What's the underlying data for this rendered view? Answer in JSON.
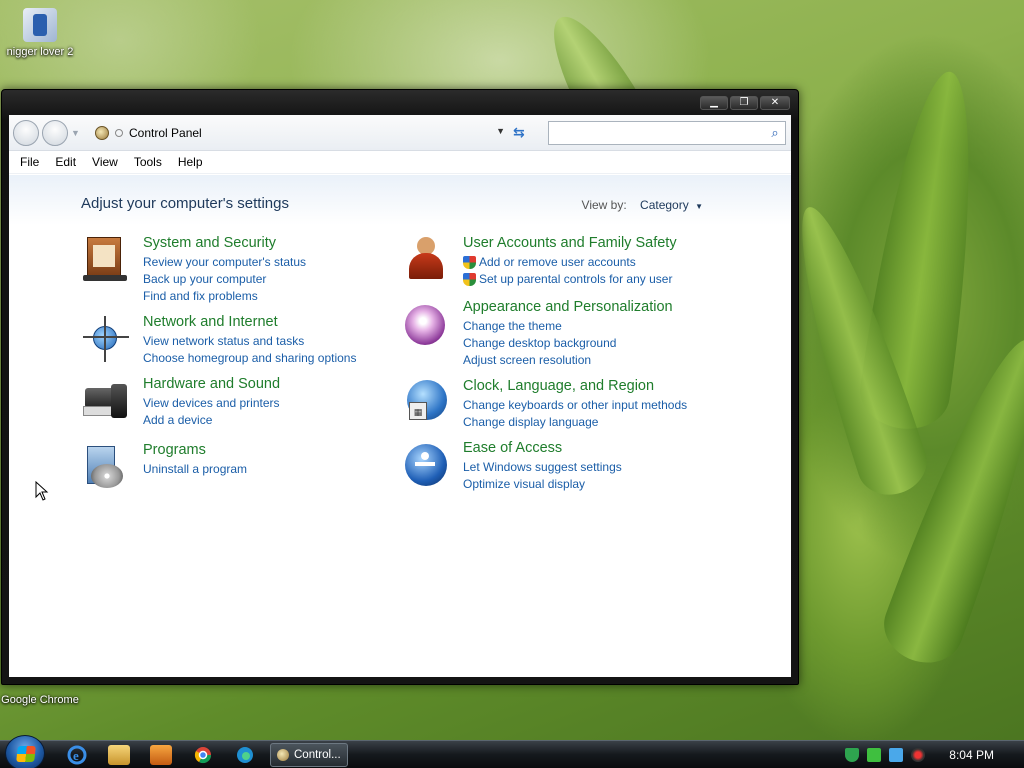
{
  "desktop": {
    "icons": [
      {
        "label": "nigger lover 2"
      },
      {
        "label": "Google Chrome"
      }
    ]
  },
  "window": {
    "controls": {
      "minimize": "▁",
      "maximize": "❐",
      "close": "✕"
    },
    "address": {
      "crumb": "Control Panel"
    },
    "search": {
      "placeholder": ""
    },
    "menu": [
      "File",
      "Edit",
      "View",
      "Tools",
      "Help"
    ],
    "content": {
      "title": "Adjust your computer's settings",
      "view_by_label": "View by:",
      "view_by_value": "Category",
      "categories": [
        {
          "title": "System and Security",
          "links": [
            "Review your computer's status",
            "Back up your computer",
            "Find and fix problems"
          ]
        },
        {
          "title": "Network and Internet",
          "links": [
            "View network status and tasks",
            "Choose homegroup and sharing options"
          ]
        },
        {
          "title": "Hardware and Sound",
          "links": [
            "View devices and printers",
            "Add a device"
          ]
        },
        {
          "title": "Programs",
          "links": [
            "Uninstall a program"
          ]
        },
        {
          "title": "User Accounts and Family Safety",
          "links": [
            "Add or remove user accounts",
            "Set up parental controls for any user"
          ]
        },
        {
          "title": "Appearance and Personalization",
          "links": [
            "Change the theme",
            "Change desktop background",
            "Adjust screen resolution"
          ]
        },
        {
          "title": "Clock, Language, and Region",
          "links": [
            "Change keyboards or other input methods",
            "Change display language"
          ]
        },
        {
          "title": "Ease of Access",
          "links": [
            "Let Windows suggest settings",
            "Optimize visual display"
          ]
        }
      ]
    }
  },
  "taskbar": {
    "task_label": "Control...",
    "clock": "8:04 PM"
  }
}
